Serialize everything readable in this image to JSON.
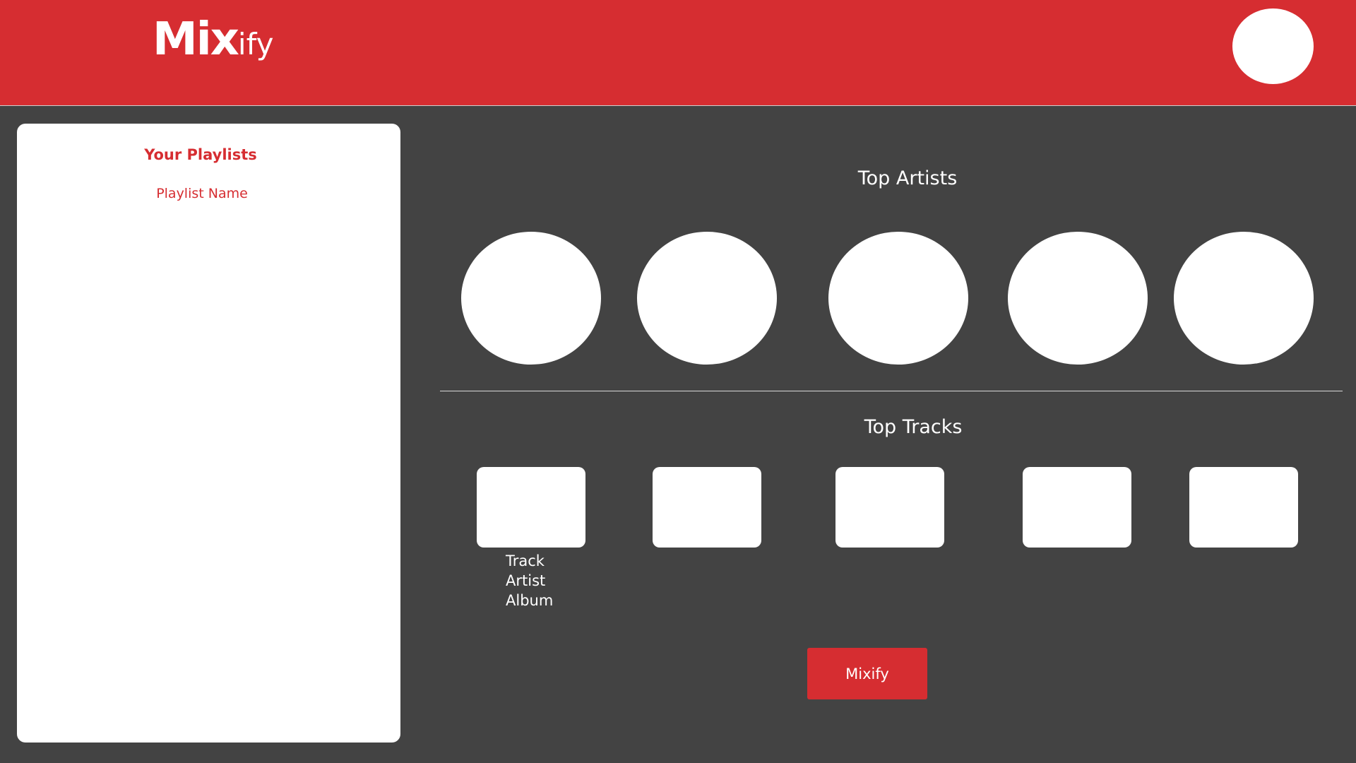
{
  "header": {
    "logo_bold": "Mix",
    "logo_light": "ify",
    "avatar_icon": "user-avatar-icon"
  },
  "sidebar": {
    "title": "Your Playlists",
    "items": [
      {
        "label": "Playlist Name"
      }
    ]
  },
  "main": {
    "top_artists": {
      "title": "Top Artists",
      "count": 5
    },
    "top_tracks": {
      "title": "Top Tracks",
      "count": 5,
      "first_track": {
        "track": "Track",
        "artist": "Artist",
        "album": "Album"
      }
    },
    "action_button_label": "Mixify"
  },
  "colors": {
    "brand_red": "#d62d31",
    "background": "#434343",
    "card": "#ffffff"
  }
}
